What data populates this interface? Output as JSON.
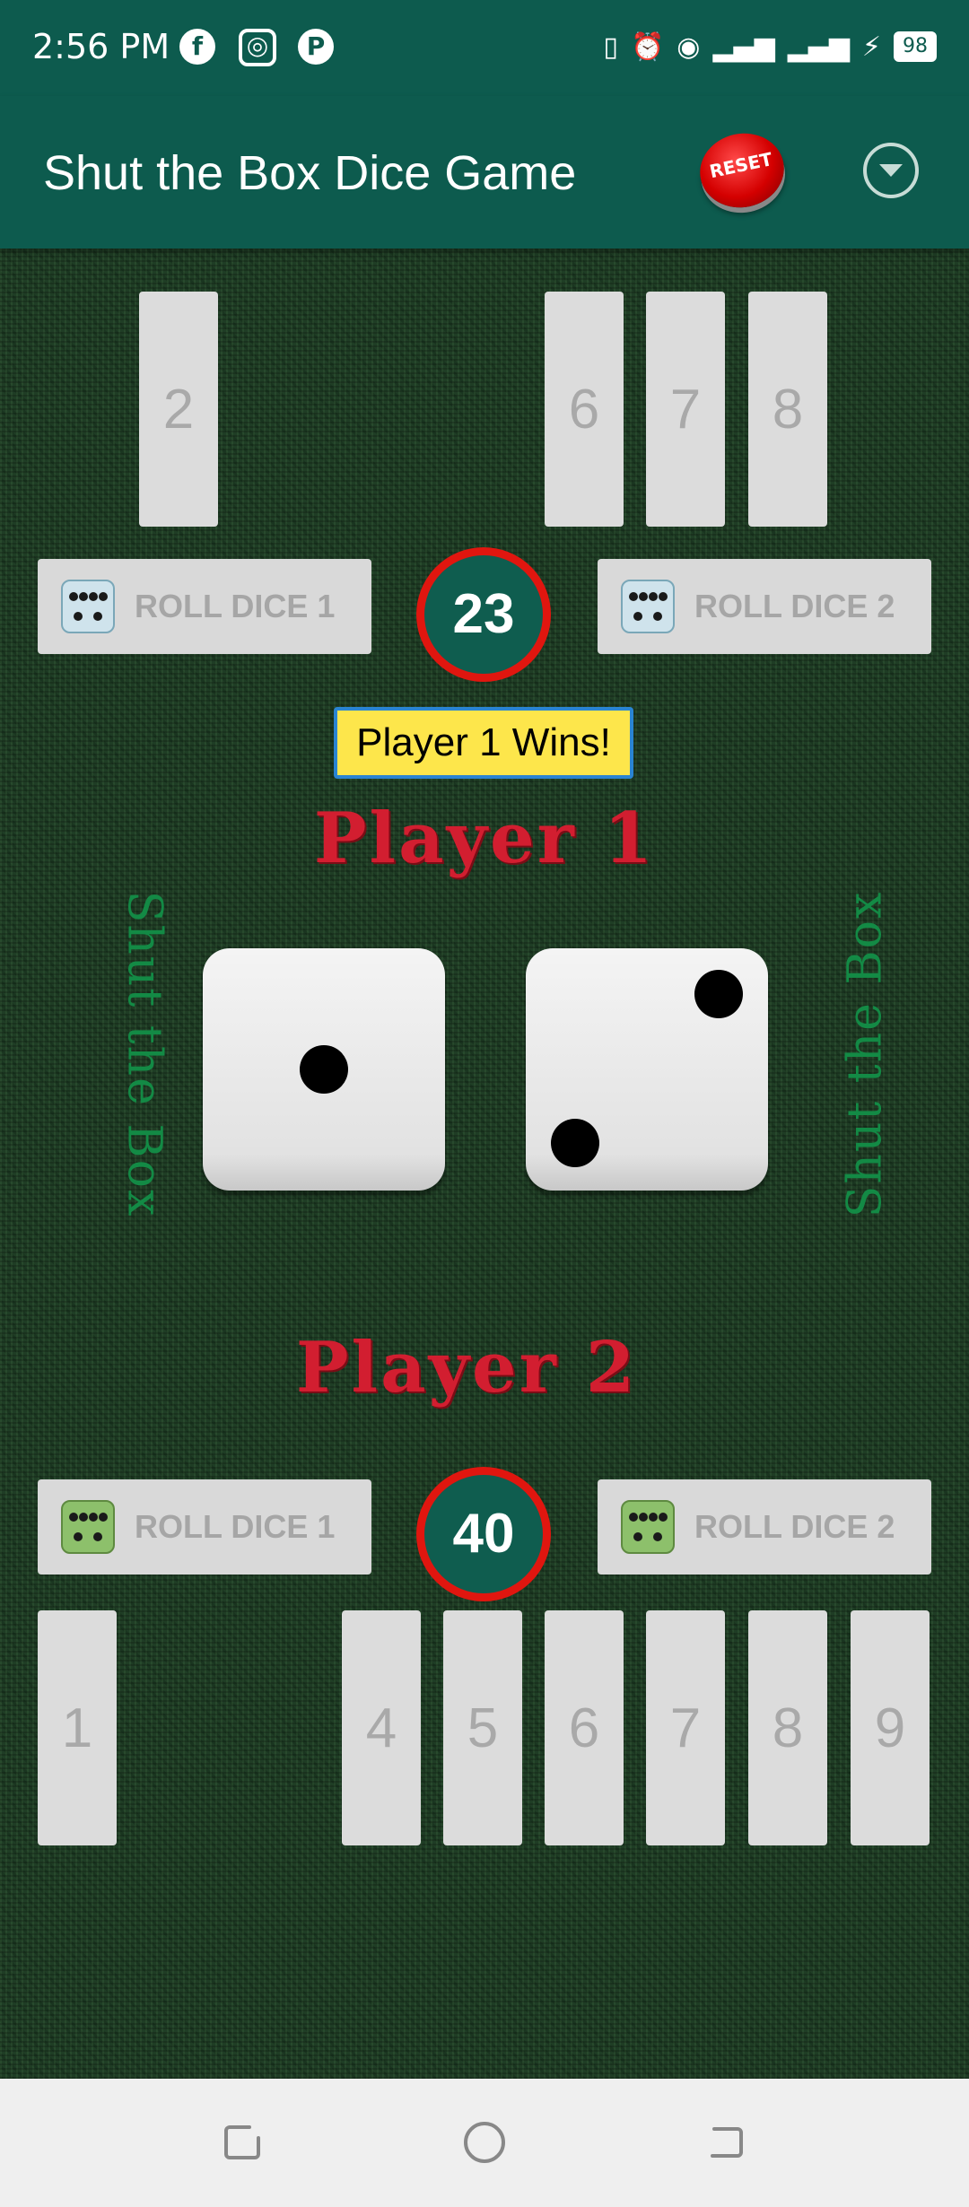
{
  "status_bar": {
    "time": "2:56 PM",
    "battery": "98"
  },
  "app_bar": {
    "title": "Shut the Box Dice Game",
    "reset_label": "RESET",
    "menu_icon": "chevron-down-circle-icon"
  },
  "player1": {
    "label": "Player 1",
    "tiles": [
      "2",
      "6",
      "7",
      "8"
    ],
    "roll1_label": "ROLL DICE 1",
    "roll2_label": "ROLL DICE 2",
    "score": "23"
  },
  "status_message": "Player 1 Wins!",
  "side_text_left": "Shut the Box",
  "side_text_right": "Shut the Box",
  "dice": {
    "die1": 1,
    "die2": 2
  },
  "player2": {
    "label": "Player 2",
    "tiles": [
      "1",
      "4",
      "5",
      "6",
      "7",
      "8",
      "9"
    ],
    "roll1_label": "ROLL DICE 1",
    "roll2_label": "ROLL DICE 2",
    "score": "40"
  },
  "colors": {
    "app_green": "#0d5b4e",
    "score_ring": "#e0160f",
    "player_label": "#d21e30",
    "winner_bg": "#fde64b"
  }
}
